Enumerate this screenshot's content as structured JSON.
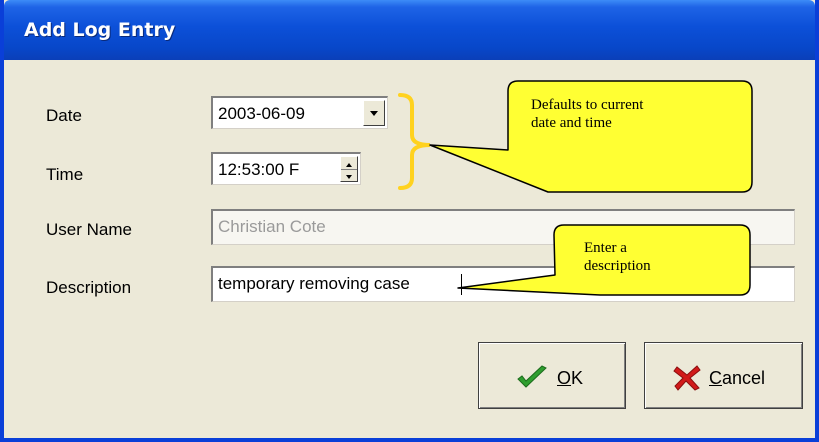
{
  "window": {
    "title": "Add Log Entry"
  },
  "form": {
    "date_label": "Date",
    "date_value": "2003-06-09",
    "time_label": "Time",
    "time_value": "12:53:00 F",
    "username_label": "User Name",
    "username_value": "Christian Cote",
    "description_label": "Description",
    "description_value": "temporary removing case"
  },
  "callouts": {
    "datetime_note": [
      "Defaults to current",
      "date and time"
    ],
    "description_note": [
      "Enter a",
      "description"
    ]
  },
  "buttons": {
    "ok_mnemonic": "O",
    "ok_rest": "K",
    "cancel_mnemonic": "C",
    "cancel_rest": "ancel"
  },
  "icons": {
    "ok": "checkmark-icon",
    "cancel": "x-icon",
    "dropdown": "chevron-down-icon",
    "spin": "spin-arrows-icon"
  },
  "colors": {
    "titlebar": "#0C50D8",
    "callout_fill": "#FFFF33",
    "bracket": "#FFD21F",
    "dialog_bg": "#ECE9D8"
  }
}
